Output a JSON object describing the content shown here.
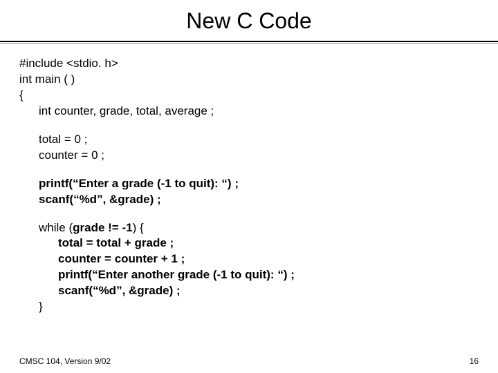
{
  "title": "New C Code",
  "code": {
    "l1": "#include <stdio. h>",
    "l2": "int main ( )",
    "l3": "{",
    "l4": "int counter, grade, total, average ;",
    "l5": "total = 0 ;",
    "l6": "counter = 0 ;",
    "l7": "printf(“Enter a grade (-1 to quit): “) ;",
    "l8": "scanf(“%d”, &grade) ;",
    "l9a": "while (",
    "l9b": "grade != -1",
    "l9c": ") {",
    "l10": "total = total + grade ;",
    "l11": "counter = counter + 1 ;",
    "l12": "printf(“Enter another grade (-1 to quit): “) ;",
    "l13": "scanf(“%d”, &grade) ;",
    "l14": "}"
  },
  "footer": {
    "left": "CMSC 104, Version 9/02",
    "right": "16"
  }
}
